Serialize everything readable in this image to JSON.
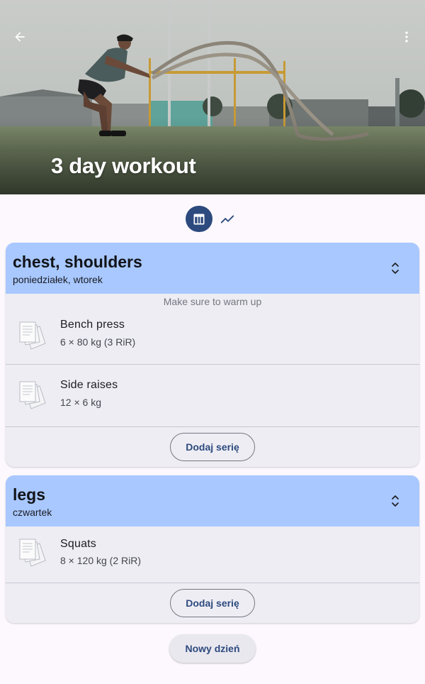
{
  "header": {
    "title": "3 day workout",
    "back_icon": "arrow-back-icon",
    "menu_icon": "more-vert-icon"
  },
  "view_toggle": {
    "options": [
      {
        "icon": "table-icon",
        "selected": true
      },
      {
        "icon": "trending-up-icon",
        "selected": false
      }
    ]
  },
  "days": [
    {
      "title": "chest, shoulders",
      "subtitle": "poniedziałek, wtorek",
      "note": "Make sure to warm up",
      "exercises": [
        {
          "name": "Bench press",
          "detail": "6 × 80 kg  (3 RiR)"
        },
        {
          "name": "Side raises",
          "detail": "12 × 6 kg"
        }
      ],
      "add_set_label": "Dodaj serię"
    },
    {
      "title": "legs",
      "subtitle": "czwartek",
      "exercises": [
        {
          "name": "Squats",
          "detail": "8 × 120 kg  (2 RiR)"
        }
      ],
      "add_set_label": "Dodaj serię"
    }
  ],
  "new_day_label": "Nowy dzień",
  "colors": {
    "primary": "#2d4a7e",
    "day_header": "#a8c8ff",
    "card_bg": "#eeedf4",
    "background": "#fcf8fd"
  }
}
